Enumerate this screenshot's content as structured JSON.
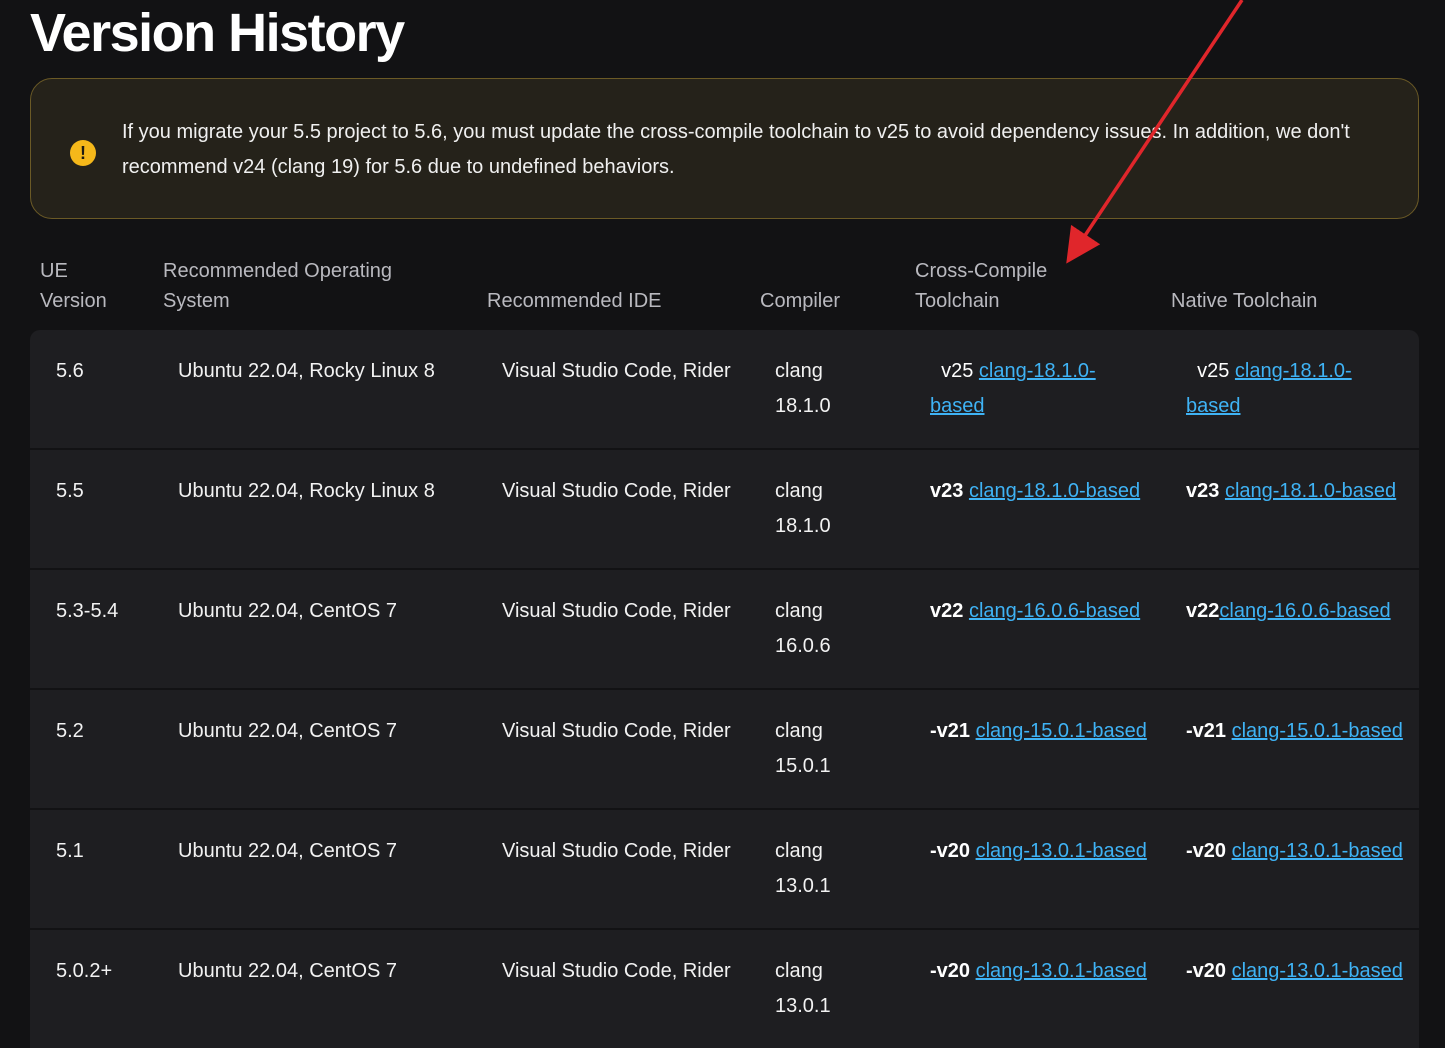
{
  "page": {
    "title": "Version History"
  },
  "callout": {
    "icon": "warning-icon",
    "icon_glyph": "!",
    "message": "If you migrate your 5.5 project to 5.6, you must update the cross-compile toolchain to v25 to avoid dependency issues. In addition, we don't recommend v24 (clang 19) for 5.6 due to undefined behaviors."
  },
  "table": {
    "headers": {
      "ue_version": "UE\nVersion",
      "os": "Recommended Operating\nSystem",
      "ide": "Recommended IDE",
      "compiler": "Compiler",
      "cross": "Cross-Compile\nToolchain",
      "native": "Native Toolchain"
    },
    "rows": [
      {
        "ue": "5.6",
        "os": "Ubuntu 22.04, Rocky Linux 8",
        "ide": "Visual Studio Code, Rider",
        "compiler": "clang 18.1.0",
        "cross_ver": "  v25 ",
        "cross_link": "clang-18.1.0-based",
        "native_ver": "  v25 ",
        "native_link": "clang-18.1.0-based"
      },
      {
        "ue": "5.5",
        "os": "Ubuntu 22.04, Rocky Linux 8",
        "ide": "Visual Studio Code, Rider",
        "compiler": "clang 18.1.0",
        "cross_ver": "v23 ",
        "cross_link": "clang-18.1.0-based",
        "native_ver": "v23 ",
        "native_link": "clang-18.1.0-based"
      },
      {
        "ue": "5.3-5.4",
        "os": "Ubuntu 22.04, CentOS 7",
        "ide": "Visual Studio Code, Rider",
        "compiler": "clang 16.0.6",
        "cross_ver": "v22 ",
        "cross_link": "clang-16.0.6-based",
        "native_ver": "v22",
        "native_link": "clang-16.0.6-based"
      },
      {
        "ue": "5.2",
        "os": "Ubuntu 22.04, CentOS 7",
        "ide": "Visual Studio Code, Rider",
        "compiler": "clang 15.0.1",
        "cross_ver": "-v21 ",
        "cross_link": "clang-15.0.1-based",
        "native_ver": "-v21 ",
        "native_link": "clang-15.0.1-based"
      },
      {
        "ue": "5.1",
        "os": "Ubuntu 22.04, CentOS 7",
        "ide": "Visual Studio Code, Rider",
        "compiler": "clang 13.0.1",
        "cross_ver": "-v20 ",
        "cross_link": "clang-13.0.1-based",
        "native_ver": "-v20 ",
        "native_link": "clang-13.0.1-based"
      },
      {
        "ue": "5.0.2+",
        "os": "Ubuntu 22.04, CentOS 7",
        "ide": "Visual Studio Code, Rider",
        "compiler": "clang 13.0.1",
        "cross_ver": "-v20 ",
        "cross_link": "clang-13.0.1-based",
        "native_ver": "-v20 ",
        "native_link": "clang-13.0.1-based"
      }
    ]
  },
  "annotation": {
    "arrow_color": "#e0262b"
  }
}
